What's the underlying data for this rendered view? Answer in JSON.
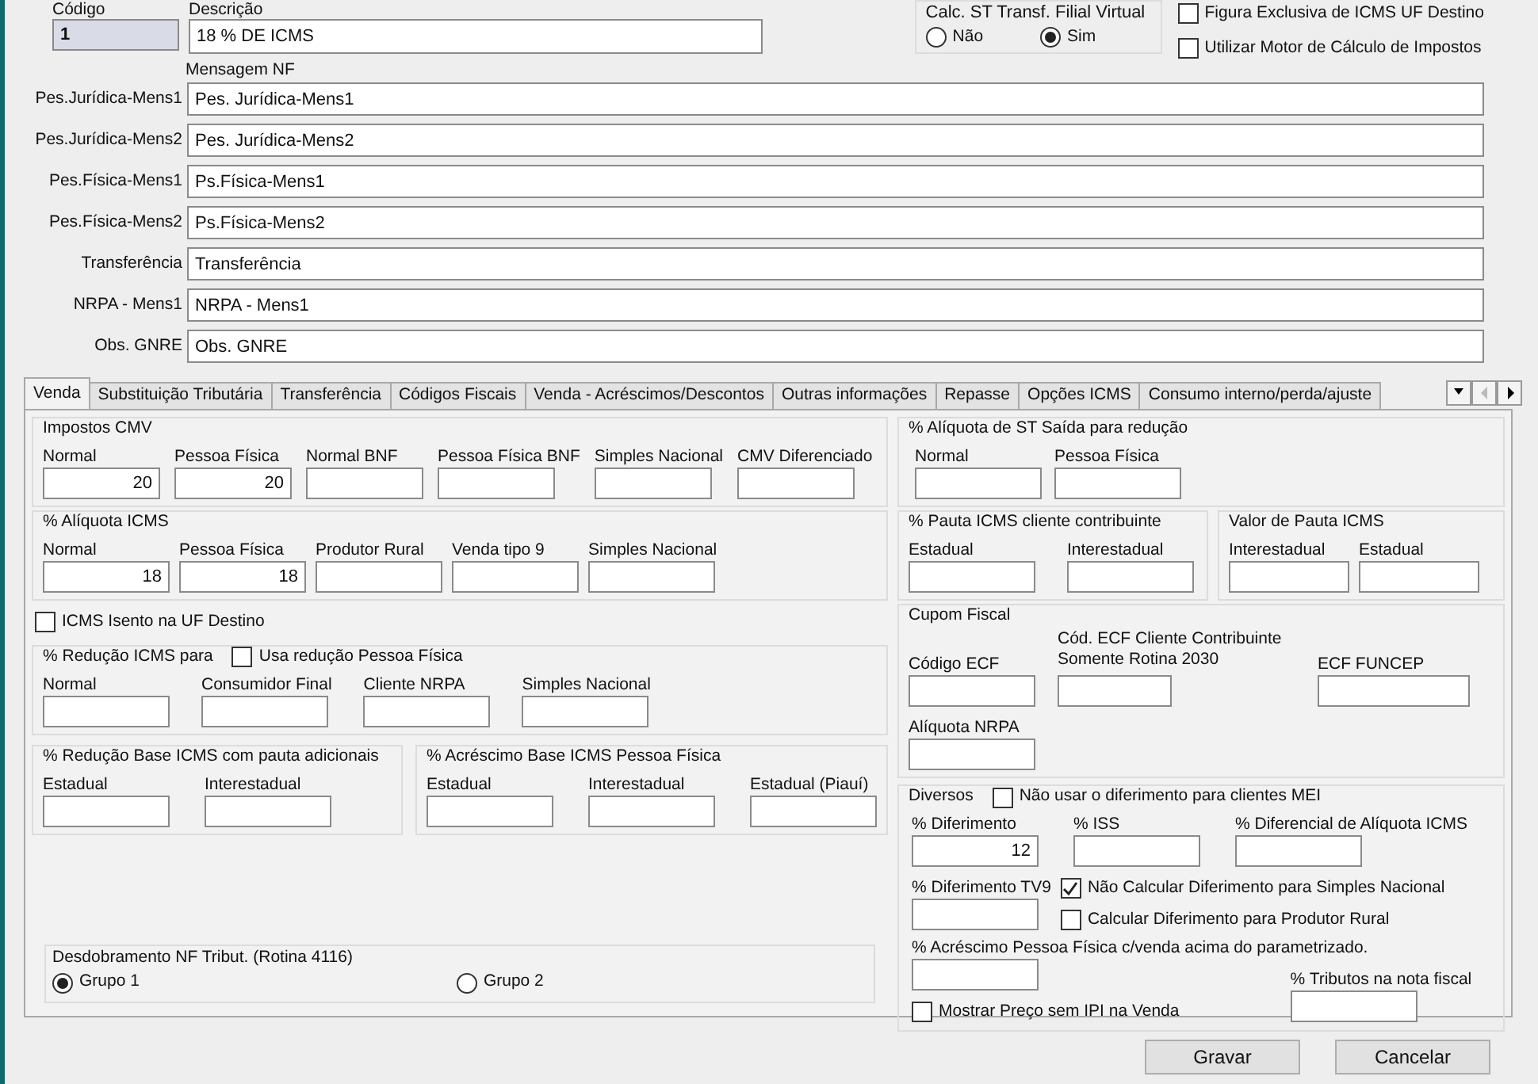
{
  "header": {
    "code_label": "Código",
    "code_value": "1",
    "description_label": "Descrição",
    "description_value": "18 % DE ICMS"
  },
  "calc_st": {
    "title": "Calc. ST Transf. Filial Virtual",
    "options": [
      {
        "label": "Não",
        "selected": false
      },
      {
        "label": "Sim",
        "selected": true
      }
    ]
  },
  "top_checks": [
    {
      "label": "Figura Exclusiva de ICMS UF Destino",
      "checked": false
    },
    {
      "label": "Utilizar Motor de Cálculo de Impostos",
      "checked": false
    }
  ],
  "messages": {
    "title": "Mensagem NF",
    "rows": [
      {
        "label": "Pes.Jurídica-Mens1",
        "value": "Pes. Jurídica-Mens1"
      },
      {
        "label": "Pes.Jurídica-Mens2",
        "value": "Pes. Jurídica-Mens2"
      },
      {
        "label": "Pes.Física-Mens1",
        "value": "Ps.Física-Mens1"
      },
      {
        "label": "Pes.Física-Mens2",
        "value": "Ps.Física-Mens2"
      },
      {
        "label": "Transferência",
        "value": "Transferência"
      },
      {
        "label": "NRPA - Mens1",
        "value": "NRPA - Mens1"
      },
      {
        "label": "Obs. GNRE",
        "value": "Obs. GNRE"
      }
    ]
  },
  "tabs": [
    {
      "label": "Venda",
      "selected": true
    },
    {
      "label": "Substituição Tributária",
      "selected": false
    },
    {
      "label": "Transferência",
      "selected": false
    },
    {
      "label": "Códigos Fiscais",
      "selected": false
    },
    {
      "label": "Venda - Acréscimos/Descontos",
      "selected": false
    },
    {
      "label": "Outras informações",
      "selected": false
    },
    {
      "label": "Repasse",
      "selected": false
    },
    {
      "label": "Opções ICMS",
      "selected": false
    },
    {
      "label": "Consumo interno/perda/ajuste",
      "selected": false
    }
  ],
  "impostos_cmv": {
    "title": "Impostos CMV",
    "fields": [
      {
        "label": "Normal",
        "value": "20"
      },
      {
        "label": "Pessoa Física",
        "value": "20"
      },
      {
        "label": "Normal BNF"
      },
      {
        "label": "Pessoa Física BNF"
      },
      {
        "label": "Simples Nacional"
      },
      {
        "label": "CMV Diferenciado"
      }
    ]
  },
  "aliquota_icms": {
    "title": "% Alíquota ICMS",
    "fields": [
      {
        "label": "Normal",
        "value": "18"
      },
      {
        "label": "Pessoa Física",
        "value": "18"
      },
      {
        "label": "Produtor Rural"
      },
      {
        "label": "Venda tipo 9"
      },
      {
        "label": "Simples Nacional"
      }
    ]
  },
  "icms_isento": {
    "label": "ICMS Isento na UF Destino",
    "checked": false
  },
  "reducao_icms": {
    "title": "% Redução ICMS para",
    "check": {
      "label": "Usa redução Pessoa Física",
      "checked": false
    },
    "fields": [
      {
        "label": "Normal"
      },
      {
        "label": "Consumidor Final"
      },
      {
        "label": "Cliente NRPA"
      },
      {
        "label": "Simples Nacional"
      }
    ]
  },
  "reducao_base": {
    "title": "% Redução Base ICMS com pauta adicionais",
    "fields": [
      {
        "label": "Estadual"
      },
      {
        "label": "Interestadual"
      }
    ]
  },
  "acrescimo_base": {
    "title": "% Acréscimo Base ICMS Pessoa Física",
    "fields": [
      {
        "label": "Estadual"
      },
      {
        "label": "Interestadual"
      },
      {
        "label": "Estadual (Piauí)"
      }
    ]
  },
  "desdobramento": {
    "title": "Desdobramento NF Tribut. (Rotina 4116)",
    "options": [
      {
        "label": "Grupo 1",
        "selected": true
      },
      {
        "label": "Grupo 2",
        "selected": false
      }
    ]
  },
  "st_saida": {
    "title": "% Alíquota de ST Saída para redução",
    "fields": [
      {
        "label": "Normal"
      },
      {
        "label": "Pessoa Física"
      }
    ]
  },
  "pauta_contribuinte": {
    "title": "% Pauta ICMS cliente contribuinte",
    "fields": [
      {
        "label": "Estadual"
      },
      {
        "label": "Interestadual"
      }
    ]
  },
  "valor_pauta": {
    "title": "Valor de Pauta ICMS",
    "fields": [
      {
        "label": "Interestadual"
      },
      {
        "label": "Estadual"
      }
    ]
  },
  "cupom_fiscal": {
    "title": "Cupom Fiscal",
    "fields": [
      {
        "label": "Código ECF"
      },
      {
        "label": "Cód. ECF Cliente Contribuinte Somente Rotina 2030"
      },
      {
        "label": "ECF FUNCEP"
      },
      {
        "label": "Alíquota NRPA"
      }
    ]
  },
  "diversos": {
    "title": "Diversos",
    "check": {
      "label": "Não usar o diferimento para clientes MEI",
      "checked": false
    },
    "fields": [
      {
        "label": "% Diferimento",
        "value": "12"
      },
      {
        "label": "% ISS"
      },
      {
        "label": "% Diferencial de Alíquota ICMS"
      },
      {
        "label": "% Diferimento TV9"
      },
      {
        "label": "% Acréscimo Pessoa Física c/venda acima do parametrizado."
      },
      {
        "label": "% Tributos na nota fiscal"
      }
    ],
    "checks": [
      {
        "label": "Não Calcular Diferimento para Simples Nacional",
        "checked": true
      },
      {
        "label": "Calcular Diferimento para Produtor Rural",
        "checked": false
      },
      {
        "label": "Mostrar Preço sem IPI na Venda",
        "checked": false
      }
    ]
  },
  "buttons": [
    "Gravar",
    "Cancelar"
  ]
}
